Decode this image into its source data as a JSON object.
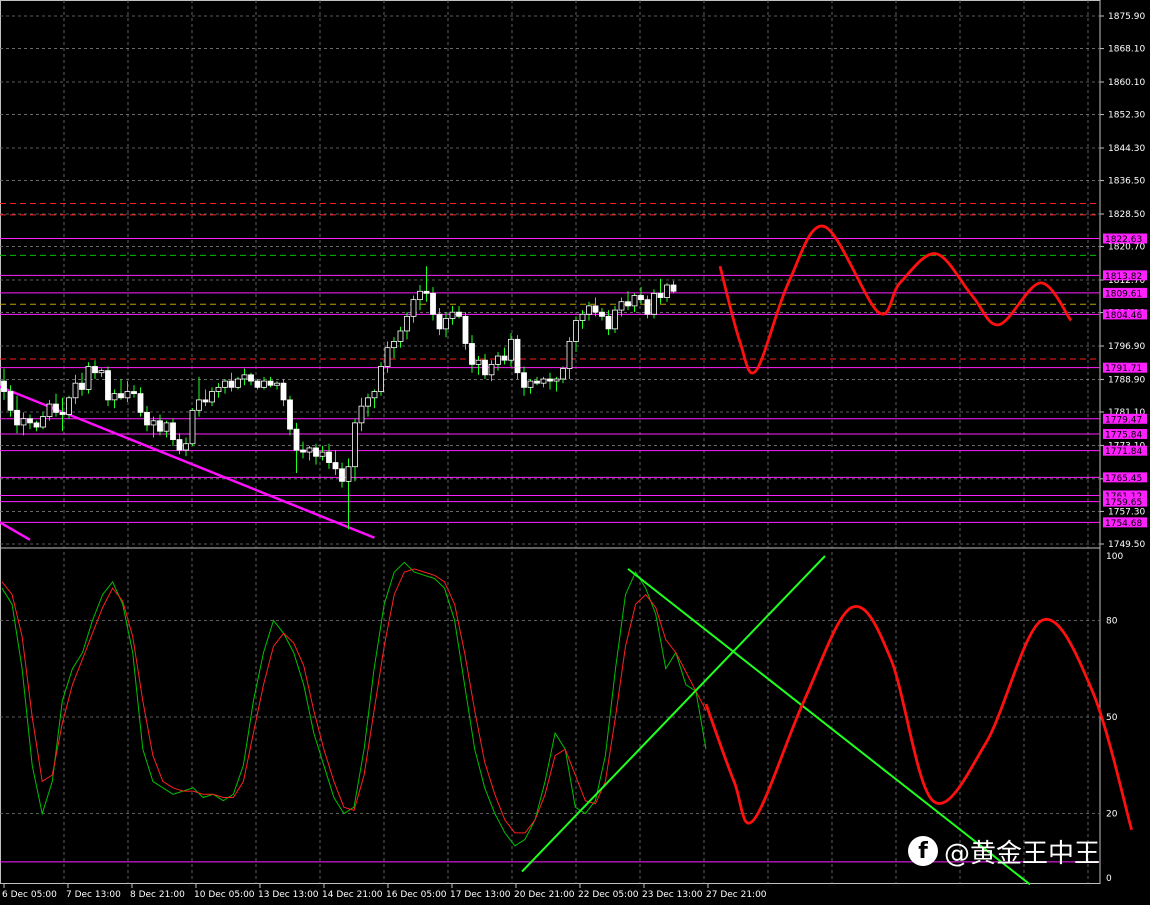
{
  "chart_data": [
    {
      "type": "candlestick",
      "instrument": "XAUUSD",
      "timeframe": "H4",
      "ylim": [
        1749.5,
        1879.8
      ],
      "y_tick_labels": [
        "1875.90",
        "1868.10",
        "1860.10",
        "1852.30",
        "1844.30",
        "1836.50",
        "1828.50",
        "1820.70",
        "1812.70",
        "1804.90",
        "1796.90",
        "1788.90",
        "1781.10",
        "1773.10",
        "1765.10",
        "1757.30",
        "1749.50"
      ],
      "x_tick_labels": [
        "6 Dec 05:00",
        "7 Dec 13:00",
        "8 Dec 21:00",
        "10 Dec 05:00",
        "13 Dec 13:00",
        "14 Dec 21:00",
        "16 Dec 05:00",
        "17 Dec 13:00",
        "20 Dec 21:00",
        "22 Dec 05:00",
        "23 Dec 13:00",
        "27 Dec 21:00"
      ],
      "price_tags": [
        "1822.63",
        "1813.82",
        "1809.61",
        "1804.46",
        "1791.71",
        "1779.47",
        "1775.84",
        "1771.84",
        "1765.45",
        "1761.12",
        "1759.65",
        "1754.68"
      ],
      "horizontal_levels": [
        1822.63,
        1813.82,
        1809.61,
        1804.46,
        1791.71,
        1779.47,
        1775.84,
        1771.84,
        1765.45,
        1761.12,
        1759.65,
        1754.68
      ],
      "dashed_levels": [
        {
          "price": 1831.0,
          "color": "#ff2020"
        },
        {
          "price": 1828.3,
          "color": "#ff2020"
        },
        {
          "price": 1818.6,
          "color": "#00c000"
        },
        {
          "price": 1806.9,
          "color": "#c0a000"
        },
        {
          "price": 1793.8,
          "color": "#ff2020"
        }
      ],
      "candles": [
        [
          1788.5,
          1791.5,
          1784.0,
          1786.0
        ],
        [
          1786.0,
          1787.5,
          1780.0,
          1781.5
        ],
        [
          1781.5,
          1785.0,
          1776.0,
          1778.0
        ],
        [
          1778.0,
          1781.0,
          1775.5,
          1779.5
        ],
        [
          1779.5,
          1780.5,
          1777.0,
          1778.5
        ],
        [
          1778.5,
          1779.0,
          1776.5,
          1777.5
        ],
        [
          1777.5,
          1781.0,
          1777.0,
          1780.0
        ],
        [
          1780.0,
          1784.0,
          1779.0,
          1783.0
        ],
        [
          1783.0,
          1785.5,
          1780.0,
          1781.0
        ],
        [
          1781.0,
          1784.5,
          1776.5,
          1780.5
        ],
        [
          1780.5,
          1785.0,
          1779.5,
          1784.5
        ],
        [
          1784.5,
          1790.0,
          1783.0,
          1788.0
        ],
        [
          1788.0,
          1790.5,
          1785.0,
          1786.5
        ],
        [
          1786.5,
          1793.0,
          1785.5,
          1792.0
        ],
        [
          1792.0,
          1793.5,
          1789.0,
          1790.5
        ],
        [
          1790.5,
          1791.5,
          1789.5,
          1791.0
        ],
        [
          1791.0,
          1792.0,
          1782.5,
          1784.0
        ],
        [
          1784.0,
          1786.5,
          1782.0,
          1785.5
        ],
        [
          1785.5,
          1789.0,
          1784.0,
          1784.5
        ],
        [
          1784.5,
          1788.5,
          1783.5,
          1786.0
        ],
        [
          1786.0,
          1787.5,
          1784.5,
          1785.5
        ],
        [
          1785.5,
          1787.0,
          1780.0,
          1781.0
        ],
        [
          1781.0,
          1782.5,
          1776.5,
          1778.0
        ],
        [
          1778.0,
          1780.0,
          1775.0,
          1779.0
        ],
        [
          1779.0,
          1780.5,
          1775.5,
          1776.5
        ],
        [
          1776.5,
          1779.0,
          1775.0,
          1778.5
        ],
        [
          1778.5,
          1779.5,
          1773.0,
          1774.5
        ],
        [
          1774.5,
          1776.0,
          1771.0,
          1772.0
        ],
        [
          1772.0,
          1775.0,
          1770.5,
          1773.5
        ],
        [
          1773.5,
          1782.0,
          1773.0,
          1781.5
        ],
        [
          1781.5,
          1789.5,
          1780.0,
          1784.0
        ],
        [
          1784.0,
          1786.5,
          1782.5,
          1783.5
        ],
        [
          1783.5,
          1787.0,
          1782.5,
          1786.0
        ],
        [
          1786.0,
          1788.0,
          1784.5,
          1787.0
        ],
        [
          1787.0,
          1789.0,
          1785.5,
          1788.5
        ],
        [
          1788.5,
          1790.5,
          1786.0,
          1787.0
        ],
        [
          1787.0,
          1789.5,
          1786.5,
          1789.0
        ],
        [
          1789.0,
          1791.5,
          1787.5,
          1790.0
        ],
        [
          1790.0,
          1790.5,
          1787.5,
          1788.5
        ],
        [
          1788.5,
          1789.0,
          1786.5,
          1787.0
        ],
        [
          1787.0,
          1789.5,
          1786.5,
          1788.5
        ],
        [
          1788.5,
          1789.5,
          1787.0,
          1787.5
        ],
        [
          1787.5,
          1788.5,
          1786.5,
          1788.0
        ],
        [
          1788.0,
          1789.0,
          1782.5,
          1784.0
        ],
        [
          1784.0,
          1785.0,
          1775.5,
          1777.0
        ],
        [
          1777.0,
          1778.5,
          1766.5,
          1772.0
        ],
        [
          1772.0,
          1774.0,
          1770.0,
          1771.5
        ],
        [
          1771.5,
          1773.0,
          1769.5,
          1772.5
        ],
        [
          1772.5,
          1773.5,
          1768.5,
          1770.5
        ],
        [
          1770.5,
          1773.0,
          1769.5,
          1771.5
        ],
        [
          1771.5,
          1773.5,
          1767.5,
          1769.0
        ],
        [
          1769.0,
          1772.0,
          1766.0,
          1767.5
        ],
        [
          1767.5,
          1769.0,
          1763.0,
          1764.5
        ],
        [
          1764.5,
          1770.0,
          1753.0,
          1768.0
        ],
        [
          1768.0,
          1779.5,
          1764.5,
          1778.5
        ],
        [
          1778.5,
          1784.5,
          1776.5,
          1782.5
        ],
        [
          1782.5,
          1785.5,
          1780.0,
          1784.5
        ],
        [
          1784.5,
          1786.5,
          1782.0,
          1786.0
        ],
        [
          1786.0,
          1793.0,
          1785.0,
          1792.0
        ],
        [
          1792.0,
          1798.0,
          1790.5,
          1796.5
        ],
        [
          1796.5,
          1799.0,
          1794.0,
          1798.0
        ],
        [
          1798.0,
          1801.5,
          1796.5,
          1800.5
        ],
        [
          1800.5,
          1805.0,
          1798.5,
          1804.0
        ],
        [
          1804.0,
          1809.0,
          1802.5,
          1808.0
        ],
        [
          1808.0,
          1811.5,
          1805.5,
          1810.0
        ],
        [
          1810.0,
          1816.0,
          1807.5,
          1809.5
        ],
        [
          1809.5,
          1811.0,
          1803.0,
          1804.5
        ],
        [
          1804.5,
          1806.0,
          1799.5,
          1801.0
        ],
        [
          1801.0,
          1805.0,
          1799.0,
          1803.5
        ],
        [
          1803.5,
          1806.5,
          1802.0,
          1805.0
        ],
        [
          1805.0,
          1806.5,
          1803.5,
          1804.0
        ],
        [
          1804.0,
          1805.0,
          1796.0,
          1797.5
        ],
        [
          1797.5,
          1799.5,
          1790.5,
          1792.5
        ],
        [
          1792.5,
          1794.5,
          1790.0,
          1793.5
        ],
        [
          1793.5,
          1795.0,
          1789.0,
          1790.0
        ],
        [
          1790.0,
          1793.5,
          1788.5,
          1792.5
        ],
        [
          1792.5,
          1795.5,
          1791.0,
          1794.5
        ],
        [
          1794.5,
          1796.5,
          1792.5,
          1793.5
        ],
        [
          1793.5,
          1800.0,
          1792.0,
          1798.5
        ],
        [
          1798.5,
          1799.5,
          1789.0,
          1790.5
        ],
        [
          1790.5,
          1792.0,
          1785.0,
          1787.0
        ],
        [
          1787.0,
          1789.0,
          1785.5,
          1788.5
        ],
        [
          1788.5,
          1789.5,
          1787.5,
          1788.0
        ],
        [
          1788.0,
          1789.5,
          1787.0,
          1789.0
        ],
        [
          1789.0,
          1790.5,
          1786.5,
          1788.5
        ],
        [
          1788.5,
          1789.5,
          1786.0,
          1789.0
        ],
        [
          1789.0,
          1792.0,
          1788.0,
          1791.5
        ],
        [
          1791.5,
          1799.0,
          1789.0,
          1798.0
        ],
        [
          1798.0,
          1804.0,
          1795.5,
          1803.0
        ],
        [
          1803.0,
          1805.5,
          1801.0,
          1804.5
        ],
        [
          1804.5,
          1807.5,
          1803.0,
          1806.5
        ],
        [
          1806.5,
          1808.5,
          1804.0,
          1805.0
        ],
        [
          1805.0,
          1806.0,
          1803.0,
          1804.0
        ],
        [
          1804.0,
          1805.5,
          1799.5,
          1801.0
        ],
        [
          1801.0,
          1806.5,
          1800.0,
          1805.5
        ],
        [
          1805.5,
          1808.5,
          1804.0,
          1807.5
        ],
        [
          1807.5,
          1810.0,
          1805.5,
          1806.5
        ],
        [
          1806.5,
          1809.5,
          1805.0,
          1809.0
        ],
        [
          1809.0,
          1811.0,
          1807.0,
          1808.0
        ],
        [
          1808.0,
          1809.0,
          1803.5,
          1804.5
        ],
        [
          1804.5,
          1810.5,
          1803.5,
          1809.5
        ],
        [
          1809.5,
          1813.0,
          1807.0,
          1808.5
        ],
        [
          1808.5,
          1812.0,
          1807.5,
          1811.5
        ],
        [
          1811.5,
          1812.5,
          1809.5,
          1810.0
        ]
      ],
      "projection_price": [
        [
          0,
          1816.0
        ],
        [
          0.11,
          1798.0
        ],
        [
          0.2,
          1791.0
        ],
        [
          0.38,
          1812.0
        ],
        [
          0.58,
          1825.5
        ],
        [
          0.88,
          1805.0
        ],
        [
          1.0,
          1812.0
        ],
        [
          1.2,
          1819.0
        ],
        [
          1.4,
          1809.0
        ],
        [
          1.55,
          1802.0
        ],
        [
          1.78,
          1812.0
        ],
        [
          1.95,
          1803.0
        ]
      ],
      "trendlines_price": [
        {
          "from": [
            -6,
            1790.5
          ],
          "to": [
            57,
            1751.0
          ],
          "color": "#ff10ff"
        },
        {
          "from": [
            -6,
            1759.5
          ],
          "to": [
            4,
            1750.5
          ],
          "color": "#ff10ff"
        }
      ]
    },
    {
      "type": "line",
      "indicator": "Stochastic",
      "ylim": [
        0,
        100
      ],
      "y_tick_labels": [
        "100",
        "80",
        "50",
        "20",
        "0"
      ],
      "levels": [
        80,
        50,
        20
      ],
      "series": [
        {
          "color": "#00c000",
          "values": [
            90,
            85,
            65,
            35,
            20,
            30,
            55,
            65,
            70,
            80,
            88,
            92,
            85,
            70,
            40,
            30,
            28,
            26,
            27,
            28,
            25,
            26,
            24,
            26,
            35,
            55,
            70,
            80,
            76,
            70,
            60,
            45,
            35,
            25,
            20,
            22,
            40,
            65,
            85,
            95,
            98,
            95,
            94,
            93,
            90,
            80,
            60,
            40,
            28,
            20,
            14,
            10,
            12,
            18,
            30,
            45,
            40,
            22,
            20,
            24,
            38,
            65,
            88,
            95,
            90,
            82,
            65,
            70,
            60,
            58,
            40
          ]
        },
        {
          "color": "#ff2020",
          "values": [
            92,
            88,
            75,
            50,
            30,
            32,
            48,
            60,
            68,
            76,
            84,
            90,
            86,
            75,
            55,
            38,
            30,
            28,
            27,
            27,
            26,
            26,
            25,
            25,
            30,
            45,
            60,
            72,
            76,
            73,
            66,
            52,
            40,
            30,
            22,
            21,
            32,
            52,
            72,
            88,
            95,
            96,
            95,
            94,
            92,
            85,
            70,
            52,
            36,
            26,
            18,
            14,
            14,
            18,
            26,
            38,
            40,
            32,
            24,
            23,
            30,
            50,
            72,
            85,
            88,
            84,
            74,
            70,
            64,
            58,
            52
          ]
        }
      ],
      "projection": [
        [
          0,
          54
        ],
        [
          0.1,
          30
        ],
        [
          0.17,
          18
        ],
        [
          0.35,
          55
        ],
        [
          0.52,
          84
        ],
        [
          0.66,
          68
        ],
        [
          0.81,
          24
        ],
        [
          1.0,
          42
        ],
        [
          1.2,
          80
        ],
        [
          1.38,
          58
        ],
        [
          1.52,
          15
        ]
      ],
      "trendlines": [
        {
          "from": [
            0,
            8
          ],
          "to": [
            1,
            100
          ],
          "color": "#20ff20"
        },
        {
          "from": [
            0,
            93
          ],
          "to": [
            1,
            0
          ],
          "color": "#20ff20"
        }
      ],
      "bottom_level": 5,
      "extra_label": "0"
    }
  ],
  "watermark": {
    "icon_letter": "f",
    "text": "@黄金王中王"
  }
}
